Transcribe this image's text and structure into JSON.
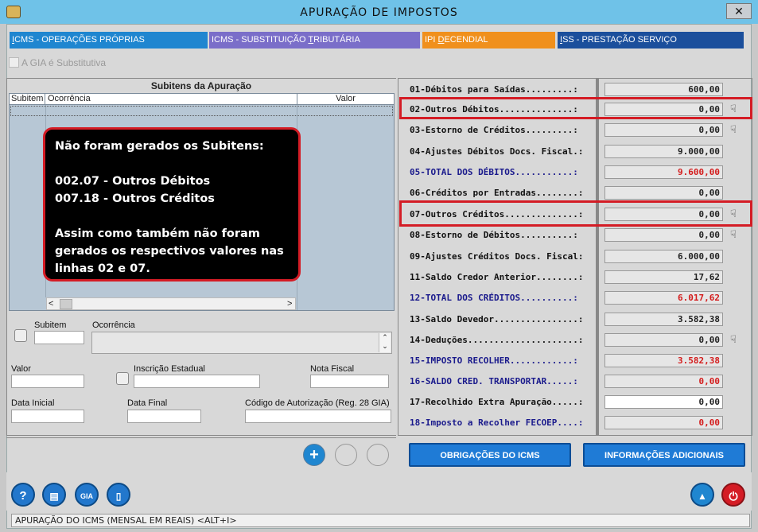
{
  "window": {
    "title": "APURAÇÃO DE IMPOSTOS",
    "close": "✕"
  },
  "tabs": [
    {
      "pre": "",
      "acc": "I",
      "post": "CMS - OPERAÇÕES PRÓPRIAS",
      "color": "#1f86d0"
    },
    {
      "pre": "ICMS - SUBSTITUIÇÃO ",
      "acc": "T",
      "post": "RIBUTÁRIA",
      "color": "#7a6ec9"
    },
    {
      "pre": "IPI ",
      "acc": "D",
      "post": "ECENDIAL",
      "color": "#f0901c"
    },
    {
      "pre": "",
      "acc": "I",
      "post": "SS - PRESTAÇÃO SERVIÇO",
      "color": "#1b4f9c"
    }
  ],
  "gia_label": "A GIA é Substitutiva",
  "subitens": {
    "title": "Subitens da Apuração",
    "col_subitem": "Subitem",
    "col_ocorrencia": "Ocorrência",
    "col_valor": "Valor",
    "scroll_left": "<",
    "scroll_right": ">"
  },
  "callout": {
    "l1": "Não foram gerados os Subitens:",
    "l2": "002.07 - Outros Débitos",
    "l3": "007.18 - Outros Créditos",
    "l4": "Assim como também não foram",
    "l5": "gerados os respectivos valores nas",
    "l6": "linhas 02 e 07."
  },
  "form": {
    "subitem": "Subitem",
    "ocorrencia": "Ocorrência",
    "valor": "Valor",
    "inscricao": "Inscrição Estadual",
    "nota": "Nota Fiscal",
    "data_inicial": "Data Inicial",
    "data_final": "Data Final",
    "codigo": "Código de Autorização (Reg. 28 GIA)"
  },
  "lines": [
    {
      "label": "01-Débitos para Saídas.........:",
      "value": "600,00",
      "color": "black",
      "hand": false
    },
    {
      "label": "02-Outros Débitos..............:",
      "value": "0,00",
      "color": "black",
      "hand": true
    },
    {
      "label": "03-Estorno de Créditos.........:",
      "value": "0,00",
      "color": "black",
      "hand": true
    },
    {
      "label": "04-Ajustes Débitos Docs. Fiscal.:",
      "value": "9.000,00",
      "color": "black",
      "hand": false
    },
    {
      "label": "05-TOTAL DOS DÉBITOS...........:",
      "value": "9.600,00",
      "color": "blue",
      "hand": false
    },
    {
      "label": "06-Créditos por Entradas........:",
      "value": "0,00",
      "color": "black",
      "hand": false
    },
    {
      "label": "07-Outros Créditos..............:",
      "value": "0,00",
      "color": "black",
      "hand": true
    },
    {
      "label": "08-Estorno de Débitos..........:",
      "value": "0,00",
      "color": "black",
      "hand": true
    },
    {
      "label": "09-Ajustes Créditos Docs. Fiscal:",
      "value": "6.000,00",
      "color": "black",
      "hand": false
    },
    {
      "label": "11-Saldo Credor Anterior........:",
      "value": "17,62",
      "color": "black",
      "hand": false
    },
    {
      "label": "12-TOTAL DOS CRÉDITOS..........:",
      "value": "6.017,62",
      "color": "blue",
      "hand": false
    },
    {
      "label": "13-Saldo Devedor................:",
      "value": "3.582,38",
      "color": "black",
      "hand": false
    },
    {
      "label": "14-Deduções.....................:",
      "value": "0,00",
      "color": "black",
      "hand": true
    },
    {
      "label": "15-IMPOSTO RECOLHER............:",
      "value": "3.582,38",
      "color": "blue",
      "hand": false
    },
    {
      "label": "16-SALDO CRED. TRANSPORTAR.....:",
      "value": "0,00",
      "color": "blue",
      "hand": false
    },
    {
      "label": "17-Recolhido Extra Apuração.....:",
      "value": "0,00",
      "color": "black",
      "hand": false
    },
    {
      "label": "18-Imposto a Recolher FECOEP....:",
      "value": "0,00",
      "color": "blue",
      "hand": false
    }
  ],
  "buttons": {
    "obrigacoes": "OBRIGAÇÕES DO ICMS",
    "informacoes": "INFORMAÇÕES ADICIONAIS",
    "help": "?",
    "gia": "GIA"
  },
  "status": "APURAÇÃO DO ICMS  (MENSAL EM REAIS) <ALT+I>"
}
